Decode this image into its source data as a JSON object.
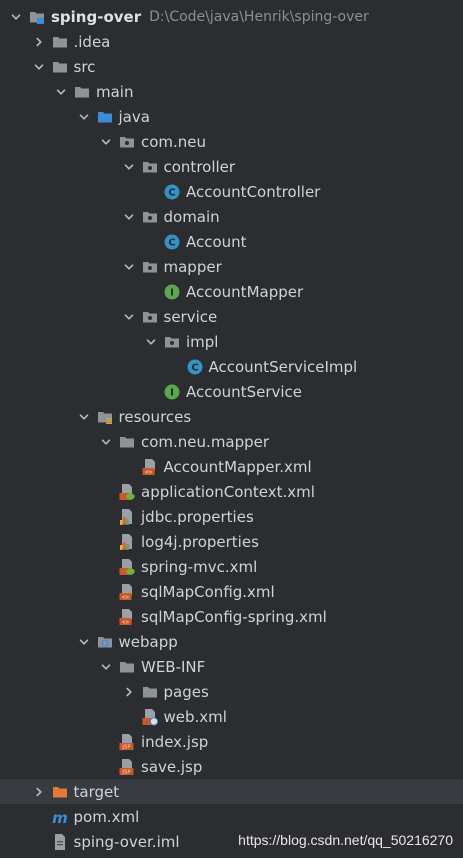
{
  "project": {
    "name": "sping-over",
    "path": "D:\\Code\\java\\Henrik\\sping-over"
  },
  "tree": [
    {
      "label": "sping-over",
      "level": 0,
      "chevron": "down",
      "icon": "module-folder-icon",
      "bold": true
    },
    {
      "label": ".idea",
      "level": 1,
      "chevron": "right",
      "icon": "folder-icon"
    },
    {
      "label": "src",
      "level": 1,
      "chevron": "down",
      "icon": "folder-icon"
    },
    {
      "label": "main",
      "level": 2,
      "chevron": "down",
      "icon": "folder-icon"
    },
    {
      "label": "java",
      "level": 3,
      "chevron": "down",
      "icon": "source-root-folder-icon"
    },
    {
      "label": "com.neu",
      "level": 4,
      "chevron": "down",
      "icon": "package-icon"
    },
    {
      "label": "controller",
      "level": 5,
      "chevron": "down",
      "icon": "package-icon"
    },
    {
      "label": "AccountController",
      "level": 6,
      "chevron": "none",
      "icon": "class-icon"
    },
    {
      "label": "domain",
      "level": 5,
      "chevron": "down",
      "icon": "package-icon"
    },
    {
      "label": "Account",
      "level": 6,
      "chevron": "none",
      "icon": "class-icon"
    },
    {
      "label": "mapper",
      "level": 5,
      "chevron": "down",
      "icon": "package-icon"
    },
    {
      "label": "AccountMapper",
      "level": 6,
      "chevron": "none",
      "icon": "interface-icon"
    },
    {
      "label": "service",
      "level": 5,
      "chevron": "down",
      "icon": "package-icon"
    },
    {
      "label": "impl",
      "level": 6,
      "chevron": "down",
      "icon": "package-icon"
    },
    {
      "label": "AccountServiceImpl",
      "level": 7,
      "chevron": "none",
      "icon": "class-icon"
    },
    {
      "label": "AccountService",
      "level": 6,
      "chevron": "none",
      "icon": "interface-icon"
    },
    {
      "label": "resources",
      "level": 3,
      "chevron": "down",
      "icon": "resources-folder-icon"
    },
    {
      "label": "com.neu.mapper",
      "level": 4,
      "chevron": "down",
      "icon": "folder-icon"
    },
    {
      "label": "AccountMapper.xml",
      "level": 5,
      "chevron": "none",
      "icon": "xml-file-icon"
    },
    {
      "label": "applicationContext.xml",
      "level": 4,
      "chevron": "none",
      "icon": "spring-xml-file-icon"
    },
    {
      "label": "jdbc.properties",
      "level": 4,
      "chevron": "none",
      "icon": "properties-file-icon"
    },
    {
      "label": "log4j.properties",
      "level": 4,
      "chevron": "none",
      "icon": "properties-file-icon"
    },
    {
      "label": "spring-mvc.xml",
      "level": 4,
      "chevron": "none",
      "icon": "spring-xml-file-icon"
    },
    {
      "label": "sqlMapConfig.xml",
      "level": 4,
      "chevron": "none",
      "icon": "xml-file-icon"
    },
    {
      "label": "sqlMapConfig-spring.xml",
      "level": 4,
      "chevron": "none",
      "icon": "xml-file-icon"
    },
    {
      "label": "webapp",
      "level": 3,
      "chevron": "down",
      "icon": "web-folder-icon"
    },
    {
      "label": "WEB-INF",
      "level": 4,
      "chevron": "down",
      "icon": "folder-icon"
    },
    {
      "label": "pages",
      "level": 5,
      "chevron": "right",
      "icon": "folder-icon"
    },
    {
      "label": "web.xml",
      "level": 5,
      "chevron": "none",
      "icon": "web-xml-file-icon"
    },
    {
      "label": "index.jsp",
      "level": 4,
      "chevron": "none",
      "icon": "jsp-file-icon"
    },
    {
      "label": "save.jsp",
      "level": 4,
      "chevron": "none",
      "icon": "jsp-file-icon"
    },
    {
      "label": "target",
      "level": 1,
      "chevron": "right",
      "icon": "excluded-folder-icon",
      "selected": true
    },
    {
      "label": "pom.xml",
      "level": 1,
      "chevron": "none",
      "icon": "maven-icon"
    },
    {
      "label": "sping-over.iml",
      "level": 1,
      "chevron": "none",
      "icon": "iml-file-icon"
    }
  ],
  "watermark": "https://blog.csdn.net/qq_50216270"
}
